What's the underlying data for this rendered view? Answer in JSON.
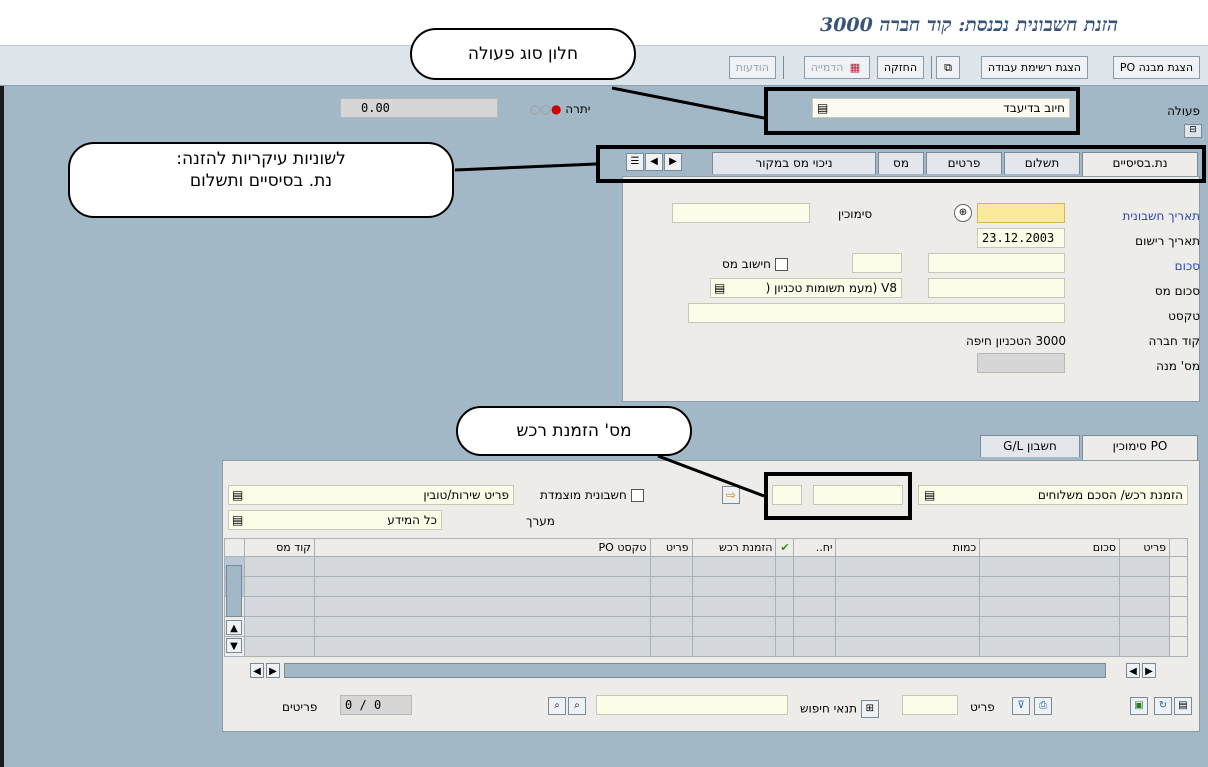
{
  "window": {
    "title": "הזנת חשבונית נכנסת: קוד חברה 3000"
  },
  "toolbar": {
    "show_po_structure": "הצגת מבנה PO",
    "show_worklist": "הצגת רשימת עבודה",
    "hold": "החזקה",
    "simulate": "הדמייה",
    "messages": "הודעות"
  },
  "header": {
    "action_label": "פעולה",
    "action_value": "חיוב בדיעבד",
    "balance_label": "יתרה",
    "balance_value": "0.00"
  },
  "tabs": [
    "נת.בסיסיים",
    "תשלום",
    "פרטים",
    "מס",
    "ניכוי מס במקור"
  ],
  "basic": {
    "invoice_date_label": "תאריך חשבונית",
    "reference_label": "סימוכין",
    "posting_date_label": "תאריך רישום",
    "posting_date_value": "23.12.2003",
    "amount_label": "סכום",
    "calc_tax_label": "חישוב מס",
    "tax_amount_label": "סכום מס",
    "tax_code_value": "V8 (מעמ תשומות טכניון (",
    "text_label": "טקסט",
    "company_code_label": "קוד חברה",
    "company_code_value": "3000 הטכניון חיפה",
    "batch_label": "מס' מנה"
  },
  "ref_tabs": [
    "PO סימוכין",
    "חשבון G/L"
  ],
  "po": {
    "ref_type_value": "הזמנת רכש/ הסכם משלוחים",
    "auto_account_label": "חשבונית מוצמדת",
    "item_type_value": "פריט שירות/טובין",
    "layout_label": "מערך",
    "layout_value": "כל המידע"
  },
  "table": {
    "columns": [
      "פריט",
      "סכום",
      "כמות",
      "יח..",
      "",
      "הזמנת רכש",
      "פריט",
      "טקסט PO",
      "קוד מס"
    ]
  },
  "footer": {
    "item_label": "פריט",
    "search_label": "תנאי חיפוש",
    "items_label": "פריטים",
    "items_count": "0",
    "items_sep": "/",
    "items_total": "0"
  },
  "callouts": {
    "action_window": "חלון סוג פעולה",
    "main_tabs": "לשוניות עיקריות להזנה:\nנת. בסיסיים ותשלום",
    "po_number": "מס' הזמנת רכש"
  },
  "colors": {
    "background": "#a3b8c6",
    "title": "#39537a",
    "required": "#fbea9b",
    "link": "#2646b0"
  }
}
